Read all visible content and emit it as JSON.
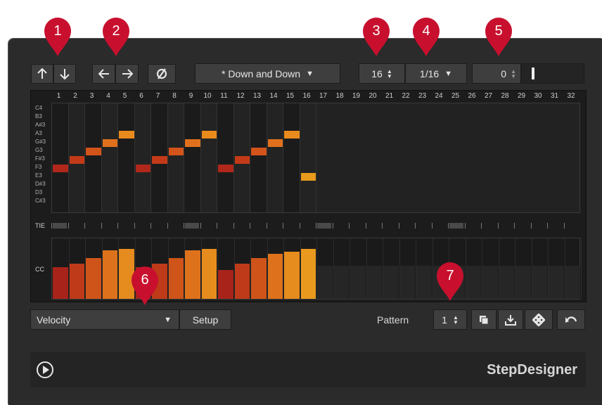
{
  "toolbar": {
    "shift_up_icon": "arrow-up",
    "shift_down_icon": "arrow-down",
    "shift_left_icon": "arrow-left",
    "shift_right_icon": "arrow-right",
    "reverse_icon": "reverse",
    "preset": "* Down and Down",
    "steps": "16",
    "resolution": "1/16",
    "swing": "0"
  },
  "callouts": [
    "1",
    "2",
    "3",
    "4",
    "5",
    "6",
    "7"
  ],
  "step_numbers": [
    "1",
    "2",
    "3",
    "4",
    "5",
    "6",
    "7",
    "8",
    "9",
    "10",
    "11",
    "12",
    "13",
    "14",
    "15",
    "16",
    "17",
    "18",
    "19",
    "20",
    "21",
    "22",
    "23",
    "24",
    "25",
    "26",
    "27",
    "28",
    "29",
    "30",
    "31",
    "32"
  ],
  "note_labels": [
    "C4",
    "B3",
    "A#3",
    "A3",
    "G#3",
    "G3",
    "F#3",
    "F3",
    "E3",
    "D#3",
    "D3",
    "C#3"
  ],
  "notes": [
    {
      "step": 1,
      "pitch": "F3",
      "color": "#b0271b"
    },
    {
      "step": 2,
      "pitch": "F#3",
      "color": "#c43a18"
    },
    {
      "step": 3,
      "pitch": "G3",
      "color": "#d2541a"
    },
    {
      "step": 4,
      "pitch": "G#3",
      "color": "#e0711c"
    },
    {
      "step": 5,
      "pitch": "A3",
      "color": "#e98a1c"
    },
    {
      "step": 6,
      "pitch": "F3",
      "color": "#b0271b"
    },
    {
      "step": 7,
      "pitch": "F#3",
      "color": "#c43a18"
    },
    {
      "step": 8,
      "pitch": "G3",
      "color": "#d2541a"
    },
    {
      "step": 9,
      "pitch": "G#3",
      "color": "#e0711c"
    },
    {
      "step": 10,
      "pitch": "A3",
      "color": "#e98a1c"
    },
    {
      "step": 11,
      "pitch": "F3",
      "color": "#b0271b"
    },
    {
      "step": 12,
      "pitch": "F#3",
      "color": "#c43a18"
    },
    {
      "step": 13,
      "pitch": "G3",
      "color": "#d2541a"
    },
    {
      "step": 14,
      "pitch": "G#3",
      "color": "#e0711c"
    },
    {
      "step": 15,
      "pitch": "A3",
      "color": "#e98a1c"
    },
    {
      "step": 16,
      "pitch": "E3",
      "color": "#e89a1c"
    }
  ],
  "tie_label": "TIE",
  "cc_label": "CC",
  "velocities": [
    0.52,
    0.58,
    0.67,
    0.8,
    0.82,
    0.52,
    0.58,
    0.67,
    0.8,
    0.82,
    0.48,
    0.58,
    0.67,
    0.74,
    0.78,
    0.82
  ],
  "velocity_colors": [
    "#a8231a",
    "#bf3a18",
    "#cf5419",
    "#de721c",
    "#e68b1d",
    "#a8231a",
    "#bf3a18",
    "#cf5419",
    "#de721c",
    "#e68b1d",
    "#a8231a",
    "#bf3a18",
    "#cf5419",
    "#de721c",
    "#e68b1d",
    "#e99a1e"
  ],
  "controller": {
    "selected": "Velocity",
    "setup_label": "Setup"
  },
  "pattern": {
    "label": "Pattern",
    "value": "1"
  },
  "footer": {
    "brand": "StepDesigner",
    "play_icon": "play-icon"
  },
  "colors": {
    "callout": "#c8102e"
  }
}
